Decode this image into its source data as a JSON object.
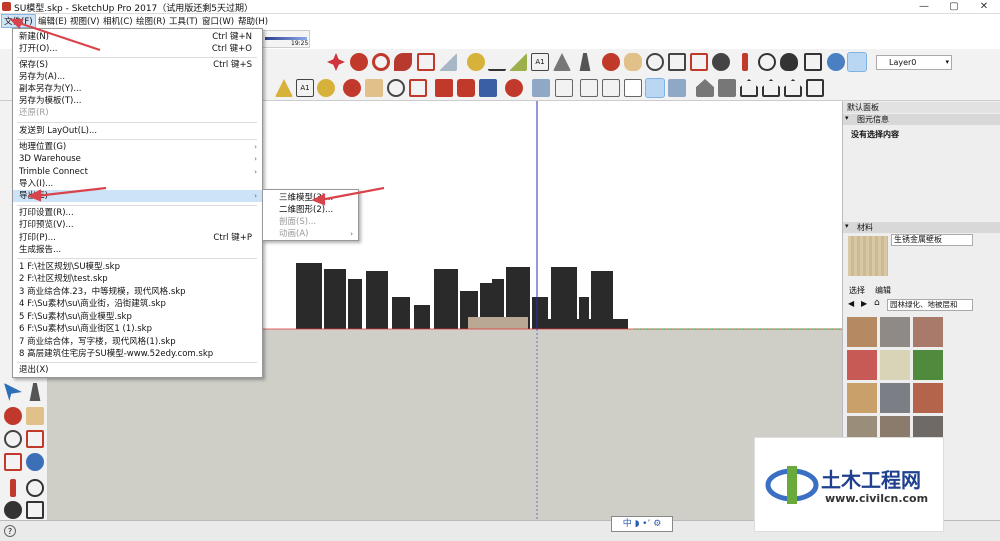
{
  "window": {
    "title": "SU模型.skp - SketchUp Pro 2017（试用版还剩5天过期）",
    "minimize": "—",
    "maximize": "▢",
    "close": "✕"
  },
  "menubar": [
    {
      "label": "文件(F)"
    },
    {
      "label": "编辑(E)"
    },
    {
      "label": "视图(V)"
    },
    {
      "label": "相机(C)"
    },
    {
      "label": "绘图(R)"
    },
    {
      "label": "工具(T)"
    },
    {
      "label": "窗口(W)"
    },
    {
      "label": "帮助(H)"
    }
  ],
  "file_menu": {
    "items": [
      {
        "label": "新建(N)",
        "shortcut": "Ctrl 键+N"
      },
      {
        "label": "打开(O)...",
        "shortcut": "Ctrl 键+O"
      },
      {
        "label": "保存(S)",
        "shortcut": "Ctrl 键+S"
      },
      {
        "label": "另存为(A)...",
        "shortcut": ""
      },
      {
        "label": "副本另存为(Y)...",
        "shortcut": ""
      },
      {
        "label": "另存为模板(T)...",
        "shortcut": ""
      },
      {
        "label": "还原(R)",
        "shortcut": ""
      },
      {
        "label": "发送到 LayOut(L)...",
        "shortcut": ""
      },
      {
        "label": "地理位置(G)",
        "shortcut": ""
      },
      {
        "label": "3D Warehouse",
        "shortcut": ""
      },
      {
        "label": "Trimble Connect",
        "shortcut": ""
      },
      {
        "label": "导入(I)...",
        "shortcut": ""
      },
      {
        "label": "导出(E)",
        "shortcut": ""
      },
      {
        "label": "打印设置(R)...",
        "shortcut": ""
      },
      {
        "label": "打印预览(V)...",
        "shortcut": ""
      },
      {
        "label": "打印(P)...",
        "shortcut": "Ctrl 键+P"
      },
      {
        "label": "生成报告...",
        "shortcut": ""
      },
      {
        "label": "1 F:\\社区规划\\SU模型.skp",
        "shortcut": ""
      },
      {
        "label": "2 F:\\社区规划\\test.skp",
        "shortcut": ""
      },
      {
        "label": "3 商业综合体.23，中等规模，现代风格.skp",
        "shortcut": ""
      },
      {
        "label": "4 F:\\Su素材\\su\\商业街，沿街建筑.skp",
        "shortcut": ""
      },
      {
        "label": "5 F:\\Su素材\\su\\商业模型.skp",
        "shortcut": ""
      },
      {
        "label": "6 F:\\Su素材\\su\\商业街区1 (1).skp",
        "shortcut": ""
      },
      {
        "label": "7 商业综合体，写字楼，现代风格(1).skp",
        "shortcut": ""
      },
      {
        "label": "8 高层建筑住宅房子SU模型-www.52edy.com.skp",
        "shortcut": ""
      },
      {
        "label": "退出(X)",
        "shortcut": ""
      }
    ]
  },
  "export_submenu": [
    {
      "label": "三维模型(3)..."
    },
    {
      "label": "二维图形(2)..."
    },
    {
      "label": "剖面(S)..."
    },
    {
      "label": "动画(A)"
    }
  ],
  "toolbar": {
    "layer_select": "Layer0",
    "time_label": "19:25"
  },
  "tray": {
    "title": "默认面板",
    "entity_info_header": "图元信息",
    "entity_info_text": "没有选择内容",
    "materials_header": "材料",
    "material_name": "生锈金属壁板",
    "tab_select": "选择",
    "tab_edit": "编辑",
    "library": "园林绿化、地被层和",
    "swatch_colors": [
      "#b58a63",
      "#8f8a86",
      "#a9796a",
      "#c85a55",
      "#d9d3b7",
      "#4f8a3d",
      "#c9a06a",
      "#7b7f85",
      "#b4644a",
      "#9a8d7a",
      "#8a7b6d",
      "#6f6a66"
    ]
  },
  "statusbar": {
    "help": "?",
    "scene_icons": "中 ◗ •ʼ ⚙"
  },
  "watermark": {
    "name": "土木工程网",
    "url": "www.civilcn.com"
  },
  "colors": {
    "accent": "#cde4f8",
    "arrow": "#d9444c"
  }
}
